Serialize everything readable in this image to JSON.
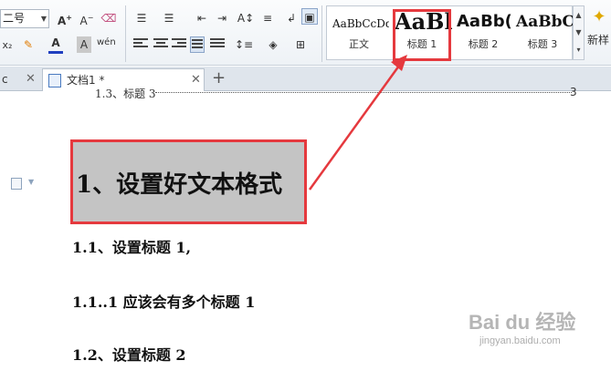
{
  "ribbon": {
    "font_size": "二号",
    "font_color": "#1f3fbf",
    "styles": [
      {
        "preview": "AaBbCcDd",
        "caption": "正文"
      },
      {
        "preview": "AaBl",
        "caption": "标题 1"
      },
      {
        "preview": "AaBb(",
        "caption": "标题 2"
      },
      {
        "preview": "AaBbC",
        "caption": "标题 3"
      }
    ],
    "new_style_label": "新样"
  },
  "tabs": [
    {
      "label": "c"
    },
    {
      "label": "文档1 *"
    }
  ],
  "document": {
    "toc_line": "1.3、标题 3",
    "toc_page": "3",
    "heading1": "1、设置好文本格式",
    "h_1_1": "1.1、设置标题 1,",
    "h_1_1_1": "1.1..1 应该会有多个标题 1",
    "h_1_2": "1.2、设置标题 2"
  },
  "watermark": {
    "text": "Bai du 经验",
    "sub": "jingyan.baidu.com"
  },
  "colors": {
    "highlight": "#e5393e",
    "heading_bg": "#c4c4c4"
  }
}
